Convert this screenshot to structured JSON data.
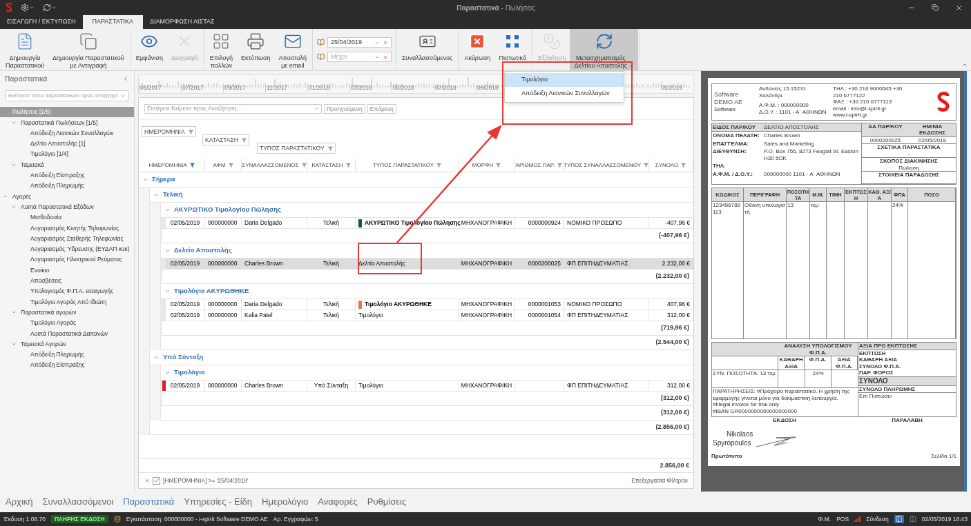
{
  "window": {
    "title": "**Παραστατικά** - Πωλήσεις"
  },
  "tabs": [
    {
      "label": "ΕΙΣΑΓΩΓΗ / ΕΚΤΥΠΩΣΗ",
      "selected": false
    },
    {
      "label": "ΠΑΡΑΣΤΑΤΙΚΑ",
      "selected": true
    },
    {
      "label": "ΔΙΑΜΟΡΦΩΣΗ ΛΙΣΤΑΣ",
      "selected": false
    }
  ],
  "ribbon": [
    [
      {
        "kind": "button",
        "label": "Δημιουργία\nΠαραστατικού",
        "disabled": false
      },
      {
        "kind": "button",
        "label": "Δημιουργία Παραστατικού\nμε Αντιγραφή",
        "disabled": false
      }
    ],
    [
      {
        "kind": "button",
        "label": "Εμφάνιση",
        "disabled": false
      },
      {
        "kind": "button",
        "label": "Διαγραφή",
        "disabled": true
      }
    ],
    [
      {
        "kind": "button",
        "label": "Επιλογή\nπολλών",
        "disabled": false
      },
      {
        "kind": "button",
        "label": "Εκτύπωση",
        "disabled": false
      },
      {
        "kind": "button",
        "label": "Αποστολή\nμε email",
        "disabled": false
      }
    ],
    [
      {
        "kind": "date",
        "value": "25/04/2019"
      },
      {
        "kind": "date",
        "placeholder": "Μέχρι"
      }
    ],
    [
      {
        "kind": "button",
        "label": "Συναλλασσόμενος",
        "disabled": false
      }
    ],
    [
      {
        "kind": "button",
        "label": "Ακύρωση",
        "disabled": false
      },
      {
        "kind": "button",
        "label": "Πιστωτικό",
        "disabled": false
      }
    ],
    [
      {
        "kind": "button",
        "label": "Εξόφληση",
        "disabled": true
      },
      {
        "kind": "menu_button",
        "label": "Μετασχηματισμός\nΔελτίου Αποστολής",
        "disabled": false,
        "expanded": true
      }
    ]
  ],
  "dropdown_menu": [
    {
      "label": "Τιμολόγιο",
      "selected": true
    },
    {
      "label": "Απόδειξη Λιανικών Συναλλαγών",
      "selected": false
    }
  ],
  "sidebar": {
    "title": "Παραστατικά",
    "search": {
      "placeholder": "Εισάγετε τύπο παραστατικού προς αναζήτησ"
    },
    "tree": [
      {
        "label": "Πωλήσεις [1/5]",
        "selected": true,
        "expanded": true,
        "children": [
          {
            "label": "Παραστατικά Πωλήσεων [1/5]",
            "selected": false,
            "expanded": true,
            "children": [
              {
                "label": "Απόδειξη Λιανικών Συναλλαγών",
                "selected": false
              },
              {
                "label": "Δελτίο Αποστολής [1]",
                "selected": false
              },
              {
                "label": "Τιμολόγιο [1/4]",
                "selected": false
              }
            ]
          },
          {
            "label": "Ταμειακά",
            "selected": false,
            "expanded": true,
            "children": [
              {
                "label": "Απόδειξη Είσπραξης",
                "selected": false
              },
              {
                "label": "Απόδειξη Πληρωμής",
                "selected": false
              }
            ]
          }
        ]
      },
      {
        "label": "Αγορές",
        "selected": false,
        "expanded": true,
        "children": [
          {
            "label": "Λοιπά Παραστατικά Εξόδων",
            "selected": false,
            "expanded": true,
            "children": [
              {
                "label": "Μισθοδοσία",
                "selected": false
              },
              {
                "label": "Λογαριασμός  Κινητής Τηλεφωνίας",
                "selected": false
              },
              {
                "label": "Λογαριασμός  Σταθερής Τηλεφωνίας",
                "selected": false
              },
              {
                "label": "Λογαριασμός Ύδρευσης (ΕΥΔΑΠ κοκ)",
                "selected": false
              },
              {
                "label": "Λογαριασμός  Ηλεκτρικού Ρεύματος",
                "selected": false
              },
              {
                "label": "Ενοίκιο",
                "selected": false
              },
              {
                "label": "Αποσβέσεις",
                "selected": false
              },
              {
                "label": "Υπολογισμός Φ.Π.Α. εισαγωγής",
                "selected": false
              },
              {
                "label": "Τιμολόγιο Αγοράς Από Ιδιώτη",
                "selected": false
              }
            ]
          },
          {
            "label": "Παραστατικά αγορών",
            "selected": false,
            "expanded": true,
            "children": [
              {
                "label": "Τιμολόγιο Αγοράς",
                "selected": false
              },
              {
                "label": "Λοιπά Παραστατικά Δαπανών",
                "selected": false
              }
            ]
          },
          {
            "label": "Ταμειακά Αγορών",
            "selected": false,
            "expanded": true,
            "children": [
              {
                "label": "Απόδειξη Πληρωμής",
                "selected": false
              },
              {
                "label": "Απόδειξη Είσπραξης",
                "selected": false
              }
            ]
          }
        ]
      }
    ]
  },
  "timeline": {
    "labels": [
      "05/2017",
      "07/2017",
      "09/2017",
      "11/2017",
      "01/2018",
      "03/2018",
      "05/2018",
      "07/2018",
      "09/2018",
      "05/2019"
    ]
  },
  "search": {
    "placeholder": "Εισάγετε Κείμενο προς Αναζήτηση...",
    "buttons": [
      "Προηγούμενη",
      "Επόμενη"
    ]
  },
  "group_panel": [
    "ΗΜΕΡΟΜΗΝΙΑ",
    "ΚΑΤΑΣΤΑΣΗ",
    "ΤΥΠΟΣ ΠΑΡΑΣΤΑΤΙΚΟΥ"
  ],
  "grid": {
    "columns": [
      {
        "label": "ΗΜΕΡΟΜΗΝΙΑ",
        "filtered": true
      },
      {
        "label": "ΑΦΜ",
        "filtered": false
      },
      {
        "label": "ΣΥΝΑΛΛΑΣΣΟΜΕΝΟΣ",
        "filtered": false
      },
      {
        "label": "ΚΑΤΑΣΤΑΣΗ",
        "filtered": false
      },
      {
        "label": "ΤΥΠΟΣ ΠΑΡΑΣΤΑΤΙΚΟΥ",
        "filtered": false
      },
      {
        "label": "ΜΟΡΦΗ",
        "filtered": false
      },
      {
        "label": "ΑΡΙΘΜΟΣ ΠΑΡ.",
        "filtered": false
      },
      {
        "label": "ΤΥΠΟΣ ΣΥΝΑΛΛΑΣΣΟΜΕΝΟΥ",
        "filtered": false
      },
      {
        "label": "ΣΥΝΟΛΟ",
        "filtered": false
      }
    ],
    "groups": [
      {
        "label": "Σήμερα",
        "expanded": true,
        "total": "(2.856,00 €)",
        "children": [
          {
            "label": "Τελική",
            "expanded": true,
            "total": "(2.544,00 €)",
            "children": [
              {
                "label": "ΑΚΥΡΩΤΙΚΟ Τιμολογίου Πώλησης",
                "expanded": true,
                "total": "(-407,96 €)",
                "rows": [
                  {
                    "cells": [
                      "02/05/2019",
                      "000000000",
                      "Daria Delgado",
                      "Τελική",
                      "ΑΚΥΡΩΤΙΚΟ Τιμολογίου Πώλησης",
                      "ΜΗΧΑΝΟΓΡΑΦΙΚΗ",
                      "0000000924",
                      "ΝΟΜΙΚΟ ΠΡΟΣΩΠΟ",
                      "-407,96 €"
                    ],
                    "color": "#1e5c1e",
                    "draft": false,
                    "selected": false
                  }
                ]
              },
              {
                "label": "Δελτίο Αποστολής",
                "expanded": true,
                "total": "(2.232,00 €)",
                "rows": [
                  {
                    "cells": [
                      "02/05/2019",
                      "000000000",
                      "Charles Brown",
                      "Τελική",
                      "Δελτίο Αποστολής",
                      "ΜΗΧΑΝΟΓΡΑΦΙΚΗ",
                      "0000200025",
                      "ΦΠ ΕΠΙΤΗΔΕΥΜΑΤΙΑΣ",
                      "2.232,00 €"
                    ],
                    "draft": false,
                    "selected": true
                  }
                ]
              },
              {
                "label": "Τιμολόγιο ΑΚΥΡΩΘΗΚΕ",
                "expanded": true,
                "total": "(719,96 €)",
                "rows": [
                  {
                    "cells": [
                      "02/05/2019",
                      "000000000",
                      "Daria Delgado",
                      "Τελική",
                      "Τιμολόγιο ΑΚΥΡΩΘΗΚΕ",
                      "ΜΗΧΑΝΟΓΡΑΦΙΚΗ",
                      "0000001053",
                      "ΝΟΜΙΚΟ ΠΡΟΣΩΠΟ",
                      "407,96 €"
                    ],
                    "color": "#e07a5a",
                    "draft": false,
                    "selected": false
                  },
                  {
                    "cells": [
                      "02/05/2019",
                      "000000000",
                      "Kalia Patel",
                      "Τελική",
                      "Τιμολόγιο",
                      "ΜΗΧΑΝΟΓΡΑΦΙΚΗ",
                      "0000001054",
                      "ΦΠ ΕΠΙΤΗΔΕΥΜΑΤΙΑΣ",
                      "312,00 €"
                    ],
                    "draft": false,
                    "selected": false
                  }
                ]
              }
            ]
          },
          {
            "label": "Υπό Σύνταξη",
            "expanded": true,
            "total": "(312,00 €)",
            "children": [
              {
                "label": "Τιμολόγιο",
                "expanded": true,
                "total": "(312,00 €)",
                "rows": [
                  {
                    "cells": [
                      "02/05/2019",
                      "000000000",
                      "Charles Brown",
                      "Υπό Σύνταξη",
                      "Τιμολόγιο",
                      "ΜΗΧΑΝΟΓΡΑΦΙΚΗ",
                      null,
                      "ΦΠ ΕΠΙΤΗΔΕΥΜΑΤΙΑΣ",
                      "312,00 €"
                    ],
                    "draft": true,
                    "selected": false
                  }
                ]
              }
            ]
          }
        ]
      }
    ],
    "grand_total": "2.856,00 €"
  },
  "filter_bar": {
    "checked": true,
    "expression": "[ΗΜΕΡΟΜΗΝΙΑ] >= '25/04/2019'",
    "edit_link": "Επεξεργασία Φίλτρου"
  },
  "preview": {
    "company": "Software DEMO AE",
    "company_sub": "Software",
    "address_lines": [
      "Ανδανιας 15 15231",
      "Χαλάνδρι",
      "Α.Φ.Μ. : 000000000",
      "Δ.Ο.Υ. : 1101 - Α΄ ΑΘΗΝΩΝ"
    ],
    "contact_lines": [
      "ΤΗΛ : +30 216 9000645 +30",
      "210 6777122",
      "ΦΑΞ : +30 210 6777113",
      "email : info@i-spirit.gr",
      "www.i-spirit.gr"
    ],
    "customer_fields": [
      {
        "label": "ΕΙΔΟΣ ΠΑΡ/ΚΟΥ",
        "value": "ΔΕΛΤΙΟ ΑΠΟΣΤΟΛΗΣ"
      },
      {
        "label": "ΟΝΟΜΑ ΠΕΛΑΤΗ:",
        "value": "Charles Brown"
      },
      {
        "label": "ΕΠΑΓΓΕΛΜΑ:",
        "value": "Sales and Marketing"
      },
      {
        "label": "ΔΙΕΥΘΥΝΣΗ:",
        "value": "P.O. Box 755, 8273 Feugiat St. Easton H30 5OK"
      },
      {
        "label": "ΤΗΛ:"
      },
      {
        "label": "Α.Φ.Μ. / Δ.Ο.Υ.:",
        "value": "000000000       1101 - Α΄ ΑΘΗΝΩΝ"
      }
    ],
    "doc_fields": [
      {
        "label": "ΑΑ ΠΑΡ/ΚΟΥ",
        "value": "0000200025"
      },
      {
        "label": "ΗΜ/ΝΙΑ ΕΚΔΟΣΗΣ",
        "value": "02/05/2019"
      }
    ],
    "doc_sections": [
      {
        "label": "ΣΧΕΤΙΚΑ ΠΑΡΑΣΤΑΤΙΚΑ",
        "value": "-"
      },
      {
        "label": "ΣΚΟΠΟΣ ΔΙΑΚΙΝΗΣΗΣ",
        "value": "Πώληση"
      },
      {
        "label": "ΣΤΟΙΧΕΙΑ ΠΑΡΑΔΟΣΗΣ"
      }
    ],
    "item_columns": [
      "ΚΩΔΙΚΟΣ",
      "ΠΕΡΙΓΡΑΦΗ",
      "ΠΟΣΟΤΗΤΑ",
      "Μ.Μ.",
      "ΤΙΜΗ",
      "ΕΚΠΤΩΣΗ",
      "ΚΑΘ. ΑΞΙΑ",
      "ΦΠΑ",
      "ΠΟΣΟ"
    ],
    "item_rows": [
      [
        "123456789 113",
        "Οθόνη υπολογιστή",
        "13",
        "τεμ",
        null,
        null,
        null,
        "24%",
        null
      ]
    ],
    "vat_title": "ΑΝΑΛΥΣΗ ΥΠΟΛΟΓΙΣΜΟΥ Φ.Π.Α.",
    "vat_columns": [
      "ΚΑΘΑΡΗ ΑΞΙΑ",
      "Φ.Π.Α.",
      "ΑΞΙΑ Φ.Π.Α."
    ],
    "vat_row": {
      "quantity": "ΣΥΝ. ΠΟΣΟΤΗΤΑ: 13 τεμ",
      "rate": "24%"
    },
    "totals_labels": [
      "ΑΞΙΑ ΠΡΟ ΕΚΠΤΩΣΗΣ",
      "ΕΚΠΤΩΣΗ",
      "ΚΑΘΑΡΗ ΑΞΙΑ",
      "ΣΥΝΟΛΟ Φ.Π.Α.",
      "ΠΑΡ. ΦΟΡΟΣ"
    ],
    "grand_label": "ΣΥΝΟΛΟ",
    "payment_label": "ΣΥΝΟΛΟ ΠΛΗΡΩΜΗΣ",
    "payment_value": "Επί Πιστώσει",
    "notes": [
      "ΠΑΡΑΤΗΡΗΣΕΙΣ: #Πρόχειρο παραστατικό. Η χρήση της εφαρμογής γίνεται μόνο για δοκιμαστική λειτουργία.",
      "#Illegal invoice for trial only",
      "#IBAN GR0000000000000000000"
    ],
    "issuer_label": "ΕΚΔΟΣΗ",
    "receiver_label": "ΠΑΡΑΛΑΒΗ",
    "signature": [
      "Nikolaos",
      "Spyropoulos"
    ],
    "copy_label": "Πρωτότυπο",
    "page": "Σελίδα 1/1"
  },
  "bottom_nav": [
    {
      "label": "Αρχική",
      "selected": false
    },
    {
      "label": "Συναλλασσόμενοι",
      "selected": false
    },
    {
      "label": "Παραστατικά",
      "selected": true
    },
    {
      "label": "Υπηρεσίες - Είδη",
      "selected": false
    },
    {
      "label": "Ημερολόγιο",
      "selected": false
    },
    {
      "label": "Αναφορές",
      "selected": false
    },
    {
      "label": "Ρυθμίσεις",
      "selected": false
    }
  ],
  "status_bar": {
    "version": "Έκδοση 1.06.70",
    "edition": "ΠΛΗΡΗΣ ΕΚΔΟΣΗ",
    "installation": "Εγκατάσταση: 000000000 - i-spirit Software DEMO AE",
    "records": "Αρ. Εγγραφών: 5",
    "right": [
      "Φ.Μ.",
      "POS"
    ],
    "connection": "Σύνδεση",
    "datetime": "02/05/2019 18:43"
  }
}
